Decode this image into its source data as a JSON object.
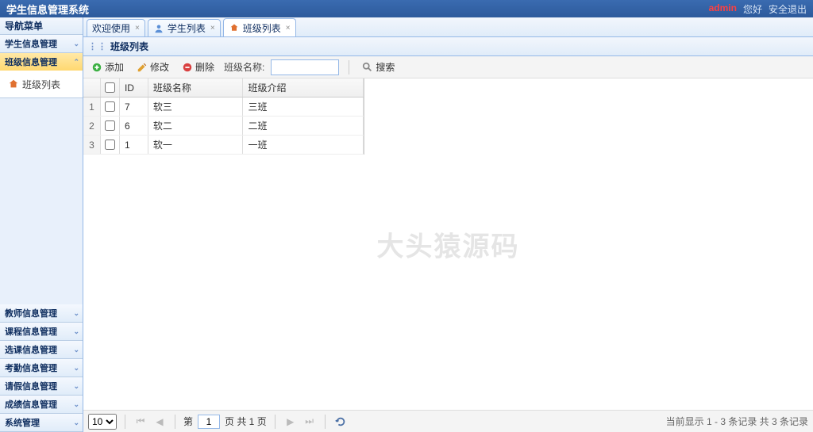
{
  "header": {
    "title": "学生信息管理系统",
    "admin": "admin",
    "hello": "您好",
    "logout": "安全退出"
  },
  "sidebar": {
    "title": "导航菜单",
    "items": [
      {
        "label": "学生信息管理",
        "expanded": false
      },
      {
        "label": "班级信息管理",
        "expanded": true,
        "link": "班级列表"
      },
      {
        "label": "教师信息管理",
        "expanded": false
      },
      {
        "label": "课程信息管理",
        "expanded": false
      },
      {
        "label": "选课信息管理",
        "expanded": false
      },
      {
        "label": "考勤信息管理",
        "expanded": false
      },
      {
        "label": "请假信息管理",
        "expanded": false
      },
      {
        "label": "成绩信息管理",
        "expanded": false
      },
      {
        "label": "系统管理",
        "expanded": false
      }
    ]
  },
  "tabs": [
    {
      "label": "欢迎使用",
      "closable": true,
      "active": false,
      "icon": "none"
    },
    {
      "label": "学生列表",
      "closable": true,
      "active": false,
      "icon": "user"
    },
    {
      "label": "班级列表",
      "closable": true,
      "active": true,
      "icon": "home"
    }
  ],
  "panel": {
    "title": "班级列表"
  },
  "toolbar": {
    "add": "添加",
    "edit": "修改",
    "delete": "删除",
    "filter_label": "班级名称:",
    "filter_value": "",
    "search": "搜索"
  },
  "grid": {
    "columns": {
      "id": "ID",
      "name": "班级名称",
      "desc": "班级介绍"
    },
    "rows": [
      {
        "n": "1",
        "id": "7",
        "name": "软三",
        "desc": "三班"
      },
      {
        "n": "2",
        "id": "6",
        "name": "软二",
        "desc": "二班"
      },
      {
        "n": "3",
        "id": "1",
        "name": "软一",
        "desc": "一班"
      }
    ],
    "watermark": "大头猿源码"
  },
  "pager": {
    "size": "10",
    "page": "1",
    "page_prefix": "第",
    "page_suffix": "页 共 1 页",
    "info": "当前显示 1 - 3 条记录 共 3 条记录"
  }
}
